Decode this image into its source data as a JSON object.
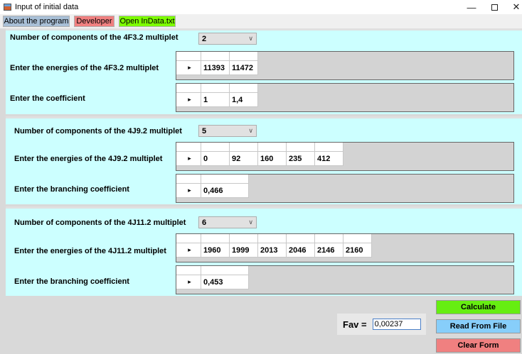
{
  "window": {
    "title": "Input of initial data",
    "controls": {
      "minimize": "—",
      "close": "✕"
    }
  },
  "menu": {
    "about": "About the program",
    "developer": "Developer",
    "open_file": "Open InData.txt"
  },
  "sections": [
    {
      "components_label": "Number of components of the 4F3.2 multiplet",
      "components_value": "2",
      "energies_label": "Enter the energies of the 4F3.2 multiplet",
      "energies": [
        "11393",
        "11472"
      ],
      "coef_label": "Enter the coefficient",
      "coef_values": [
        "1",
        "1,4"
      ]
    },
    {
      "components_label": "Number of components of the 4J9.2 multiplet",
      "components_value": "5",
      "energies_label": "Enter the energies of the 4J9.2 multiplet",
      "energies": [
        "0",
        "92",
        "160",
        "235",
        "412"
      ],
      "coef_label": "Enter the branching coefficient",
      "coef_values": [
        "0,466"
      ]
    },
    {
      "components_label": "Number of components of the 4J11.2 multiplet",
      "components_value": "6",
      "energies_label": "Enter the energies of the 4J11.2 multiplet",
      "energies": [
        "1960",
        "1999",
        "2013",
        "2046",
        "2146",
        "2160"
      ],
      "coef_label": "Enter the branching coefficient",
      "coef_values": [
        "0,453"
      ]
    }
  ],
  "row_marker": "▸",
  "fav": {
    "label": "Fav =",
    "value": "0,00237"
  },
  "actions": {
    "calculate": "Calculate",
    "read_from_file": "Read From File",
    "clear_form": "Clear Form"
  },
  "colors": {
    "panel": "#ccffff",
    "calculate": "#66ee11",
    "read_from_file": "#87cefa",
    "clear_form": "#f08080"
  }
}
